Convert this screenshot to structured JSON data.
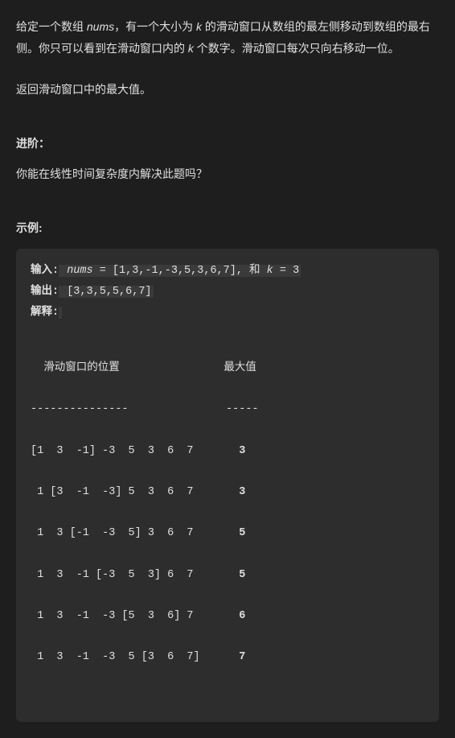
{
  "description": {
    "line1_part1": "给定一个数组 ",
    "line1_nums": "nums",
    "line1_part2": "，有一个大小为 ",
    "line1_k": "k",
    "line1_part3": " 的滑动窗口从数组的最左侧移动到数组的最右侧。你只可以看到在滑动窗口内的 ",
    "line1_k2": "k",
    "line1_part4": " 个数字。滑动窗口每次只向右移动一位。",
    "return": "返回滑动窗口中的最大值。"
  },
  "advanced": {
    "header": "进阶：",
    "question": "你能在线性时间复杂度内解决此题吗？"
  },
  "example": {
    "header": "示例:",
    "input_label": "输入:",
    "input_value": " nums = [1,3,-1,-3,5,3,6,7], 和 k = 3",
    "output_label": "输出:",
    "output_value": " [3,3,5,5,6,7] ",
    "explain_label": "解释:",
    "table_header": "  滑动窗口的位置                最大值",
    "table_divider": "---------------               -----",
    "rows": [
      {
        "window": "[1  3  -1] -3  5  3  6  7      ",
        "max": " 3"
      },
      {
        "window": " 1 [3  -1  -3] 5  3  6  7      ",
        "max": " 3"
      },
      {
        "window": " 1  3 [-1  -3  5] 3  6  7      ",
        "max": " 5"
      },
      {
        "window": " 1  3  -1 [-3  5  3] 6  7      ",
        "max": " 5"
      },
      {
        "window": " 1  3  -1  -3 [5  3  6] 7      ",
        "max": " 6"
      },
      {
        "window": " 1  3  -1  -3  5 [3  6  7]     ",
        "max": " 7"
      }
    ]
  }
}
